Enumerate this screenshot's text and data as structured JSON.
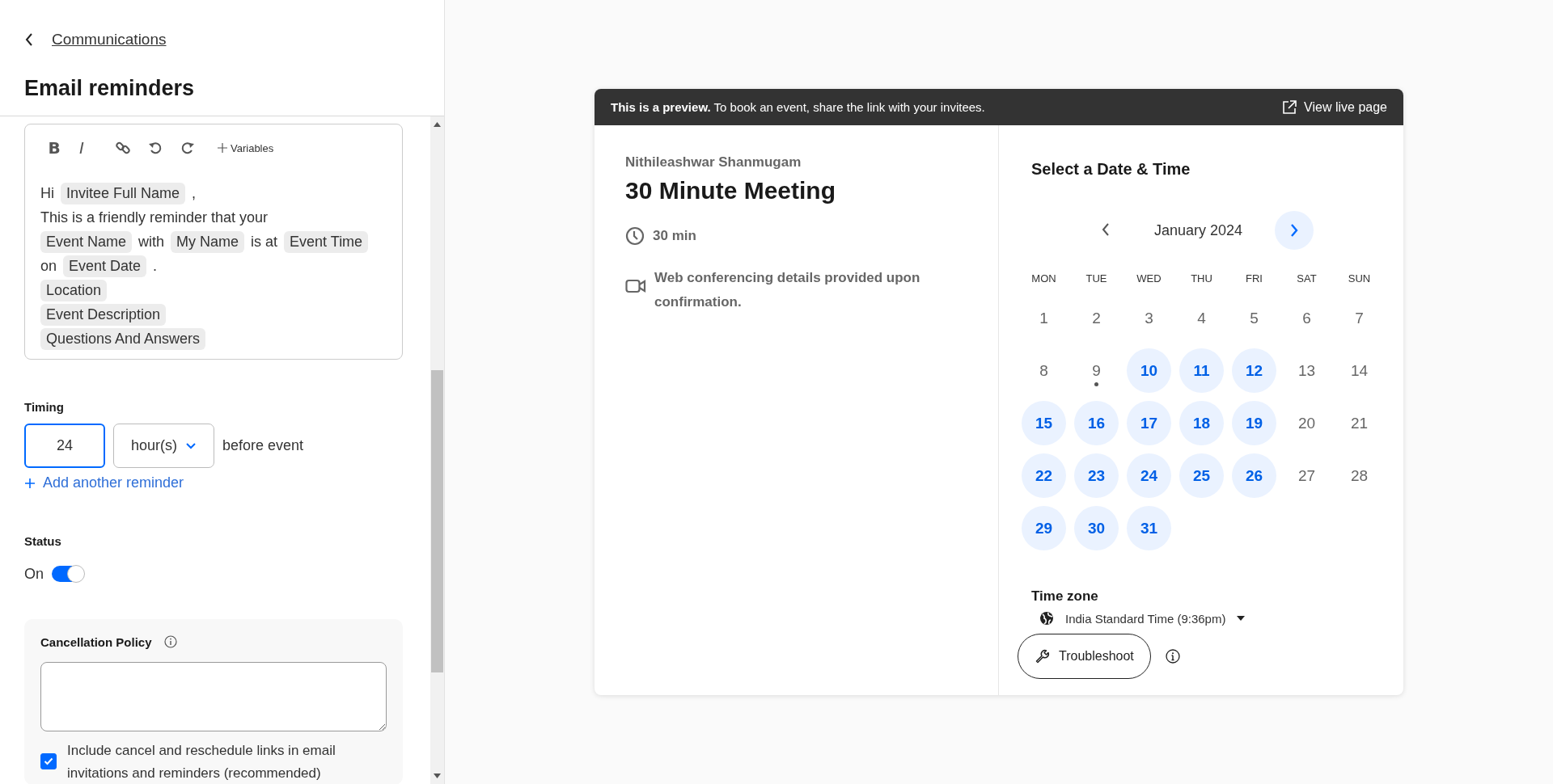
{
  "back_link": {
    "label": "Communications"
  },
  "panel_title": "Email reminders",
  "editor": {
    "toolbar": [
      {
        "kind": "bold",
        "label": "B"
      },
      {
        "kind": "italic",
        "label": "I"
      },
      {
        "kind": "link"
      },
      {
        "kind": "undo"
      },
      {
        "kind": "redo"
      },
      {
        "kind": "variables",
        "label": "Variables"
      }
    ],
    "lines": [
      [
        {
          "kind": "text",
          "text": "Hi"
        },
        {
          "kind": "variable",
          "text": "Invitee Full Name"
        },
        {
          "kind": "text",
          "text": ","
        }
      ],
      [
        {
          "kind": "text",
          "text": "This is a friendly reminder that your"
        }
      ],
      [
        {
          "kind": "variable",
          "text": "Event Name"
        },
        {
          "kind": "text",
          "text": "with"
        },
        {
          "kind": "variable",
          "text": "My Name"
        },
        {
          "kind": "text",
          "text": "is at"
        },
        {
          "kind": "variable",
          "text": "Event Time"
        }
      ],
      [
        {
          "kind": "text",
          "text": "on"
        },
        {
          "kind": "variable",
          "text": "Event Date"
        },
        {
          "kind": "text",
          "text": "."
        }
      ],
      [
        {
          "kind": "variable",
          "text": "Location"
        }
      ],
      [
        {
          "kind": "variable",
          "text": "Event Description"
        }
      ],
      [
        {
          "kind": "variable",
          "text": "Questions And Answers"
        }
      ]
    ]
  },
  "timing": {
    "label": "Timing",
    "amount": "24",
    "unit": "hour(s)",
    "suffix": "before event",
    "add_link": "Add another reminder"
  },
  "status": {
    "label": "Status",
    "state_label": "On",
    "on": true
  },
  "cancellation": {
    "title": "Cancellation Policy",
    "checkbox": {
      "label": "Include cancel and reschedule links in email invitations and reminders (recommended)",
      "checked": true
    }
  },
  "preview": {
    "banner": {
      "text": "**This is a preview.** To book an event, share the link with your invitees.",
      "action": "View live page"
    },
    "host": "Nithileashwar Shanmugam",
    "event_title": "30 Minute Meeting",
    "duration": "30 min",
    "location": "Web conferencing details provided upon confirmation.",
    "calendar": {
      "title": "Select a Date & Time",
      "month": "January 2024",
      "weekdays": [
        "MON",
        "TUE",
        "WED",
        "THU",
        "FRI",
        "SAT",
        "SUN"
      ],
      "days": [
        {
          "label": "1",
          "available": false,
          "today": false
        },
        {
          "label": "2",
          "available": false,
          "today": false
        },
        {
          "label": "3",
          "available": false,
          "today": false
        },
        {
          "label": "4",
          "available": false,
          "today": false
        },
        {
          "label": "5",
          "available": false,
          "today": false
        },
        {
          "label": "6",
          "available": false,
          "today": false
        },
        {
          "label": "7",
          "available": false,
          "today": false
        },
        {
          "label": "8",
          "available": false,
          "today": false
        },
        {
          "label": "9",
          "available": false,
          "today": true
        },
        {
          "label": "10",
          "available": true,
          "today": false
        },
        {
          "label": "11",
          "available": true,
          "today": false
        },
        {
          "label": "12",
          "available": true,
          "today": false
        },
        {
          "label": "13",
          "available": false,
          "today": false
        },
        {
          "label": "14",
          "available": false,
          "today": false
        },
        {
          "label": "15",
          "available": true,
          "today": false
        },
        {
          "label": "16",
          "available": true,
          "today": false
        },
        {
          "label": "17",
          "available": true,
          "today": false
        },
        {
          "label": "18",
          "available": true,
          "today": false
        },
        {
          "label": "19",
          "available": true,
          "today": false
        },
        {
          "label": "20",
          "available": false,
          "today": false
        },
        {
          "label": "21",
          "available": false,
          "today": false
        },
        {
          "label": "22",
          "available": true,
          "today": false
        },
        {
          "label": "23",
          "available": true,
          "today": false
        },
        {
          "label": "24",
          "available": true,
          "today": false
        },
        {
          "label": "25",
          "available": true,
          "today": false
        },
        {
          "label": "26",
          "available": true,
          "today": false
        },
        {
          "label": "27",
          "available": false,
          "today": false
        },
        {
          "label": "28",
          "available": false,
          "today": false
        },
        {
          "label": "29",
          "available": true,
          "today": false
        },
        {
          "label": "30",
          "available": true,
          "today": false
        },
        {
          "label": "31",
          "available": true,
          "today": false
        }
      ]
    },
    "timezone": {
      "label": "Time zone",
      "value": "India Standard Time (9:36pm)"
    },
    "troubleshoot": "Troubleshoot"
  }
}
